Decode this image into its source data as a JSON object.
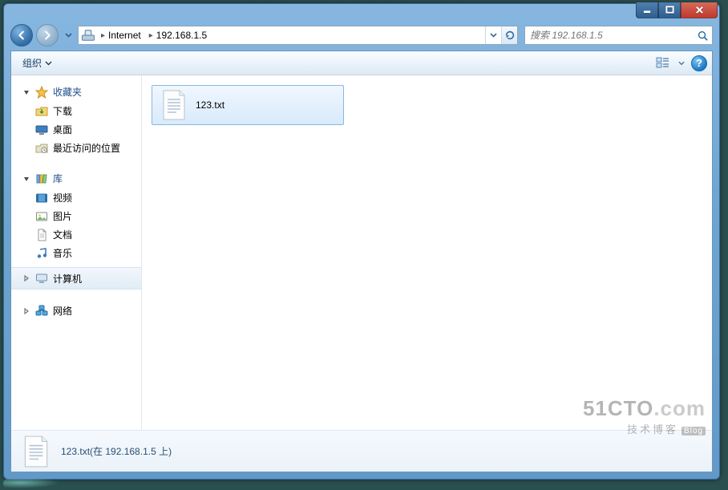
{
  "titlebar": {
    "min": "minimize",
    "max": "maximize",
    "close": "close"
  },
  "nav_buttons": {
    "back": "back",
    "forward": "forward"
  },
  "breadcrumb": {
    "root": "Internet",
    "location": "192.168.1.5"
  },
  "search": {
    "prefix": "搜索",
    "placeholder": "搜索 192.168.1.5"
  },
  "toolbar": {
    "organize": "组织"
  },
  "sidebar": {
    "favorites": {
      "label": "收藏夹",
      "items": [
        "下载",
        "桌面",
        "最近访问的位置"
      ]
    },
    "libraries": {
      "label": "库",
      "items": [
        "视频",
        "图片",
        "文档",
        "音乐"
      ]
    },
    "computer": {
      "label": "计算机"
    },
    "network": {
      "label": "网络"
    }
  },
  "files": [
    {
      "name": "123.txt"
    }
  ],
  "details": {
    "caption": "123.txt(在 192.168.1.5 上)"
  },
  "watermark": {
    "line1a": "51CTO",
    "line1b": ".com",
    "line2": "技术博客",
    "tag": "Blog"
  }
}
